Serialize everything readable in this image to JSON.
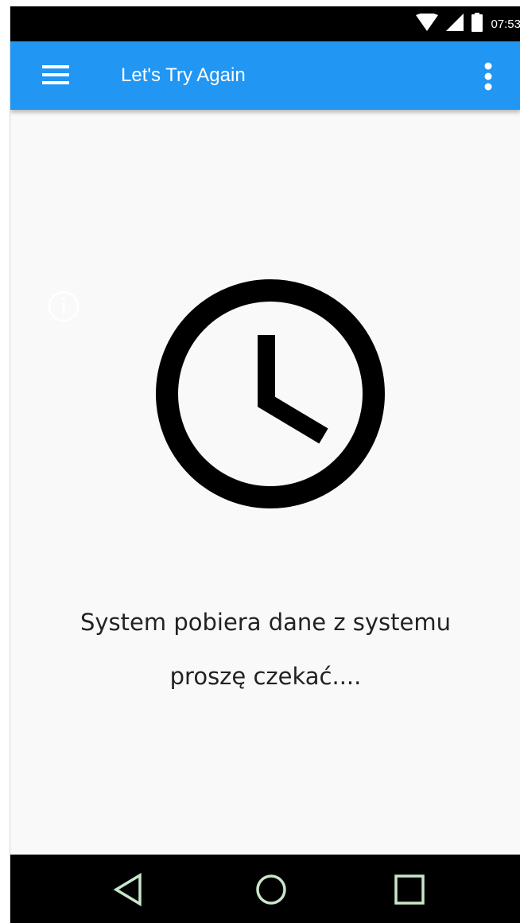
{
  "status_bar": {
    "time": "07:53",
    "icons": [
      "wifi-icon",
      "signal-icon",
      "battery-icon"
    ]
  },
  "app_bar": {
    "title": "Let's Try Again",
    "background_color": "#2196f3",
    "menu_icon": "hamburger-menu-icon",
    "overflow_icon": "more-vertical-icon"
  },
  "content": {
    "info_icon": "info-icon",
    "clock_icon": "clock-icon",
    "message_line1": "System pobiera dane z systemu",
    "message_line2": "proszę czekać...."
  },
  "nav_bar": {
    "buttons": [
      "back-icon",
      "home-icon",
      "recents-icon"
    ]
  }
}
